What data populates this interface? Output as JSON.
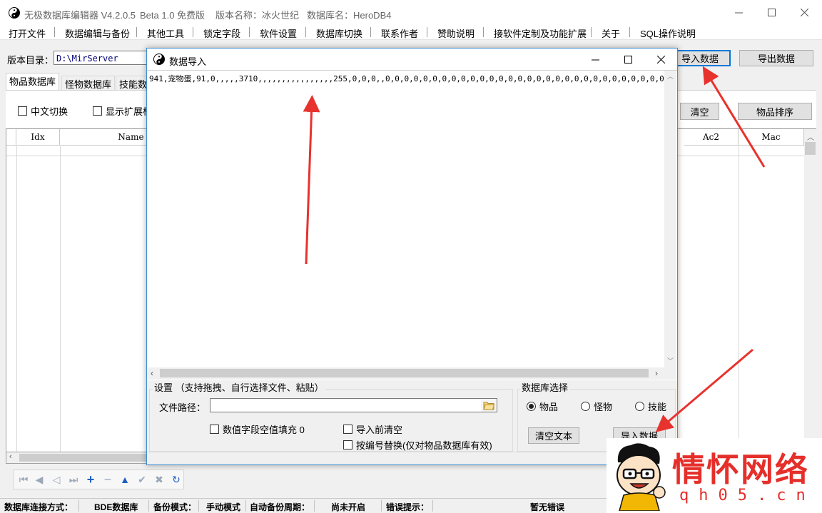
{
  "app": {
    "title_parts": [
      "无极数据库编辑器 V4.2.0.5",
      "Beta 1.0 免费版",
      "版本名称：冰火世纪",
      "数据库名：HeroDB4"
    ]
  },
  "menu": [
    "打开文件",
    "数据编辑与备份",
    "其他工具",
    "锁定字段",
    "软件设置",
    "数据库切换",
    "联系作者",
    "赞助说明",
    "接软件定制及功能扩展",
    "关于",
    "SQL操作说明"
  ],
  "toolbar": {
    "dir_label": "版本目录：",
    "dir_value": "D:\\MirServer",
    "import_button": "导入数据",
    "export_button": "导出数据"
  },
  "tabs": [
    "物品数据库",
    "怪物数据库",
    "技能数"
  ],
  "options": {
    "chinese_switch": "中文切换",
    "show_ext": "显示扩展标",
    "clear_button": "清空",
    "sort_button": "物品排序"
  },
  "grid": {
    "columns_left": [
      "Idx",
      "Name"
    ],
    "columns_right": [
      "Ac2",
      "Mac"
    ]
  },
  "dialog": {
    "title": "数据导入",
    "text_content": "941,宠物蛋,91,0,,,,,3710,,,,,,,,,,,,,,,,255,0,0,0,,0,0,0,0,0,0,0,0,0,0,0,0,0,0,0,0,0,0,0,0,0,0,0,0,0,0,0,0,0,0,0,0,0,0,0",
    "settings_label": "设置  （支持拖拽、自行选择文件、粘贴）",
    "file_path_label": "文件路径：",
    "file_path_value": "",
    "opt_fill_empty": "数值字段空值填充 0",
    "opt_clear_before": "导入前清空",
    "opt_replace_by_id": "按编号替换(仅对物品数据库有效)",
    "db_select_label": "数据库选择",
    "radio_items": "物品",
    "radio_monsters": "怪物",
    "radio_skills": "技能",
    "radio_selected": "物品",
    "clear_text_button": "清空文本",
    "import_button": "导入数据"
  },
  "statusbar": {
    "conn_label": "数据库连接方式：",
    "conn_value": "BDE数据库",
    "backup_label": "备份模式：",
    "backup_value": "手动模式",
    "auto_label": "自动备份周期：",
    "auto_value": "尚未开启",
    "error_label": "错误提示：",
    "error_value": "暂无错误"
  },
  "watermark": {
    "text": "情怀网络",
    "domain": "qh05.cn"
  },
  "colors": {
    "accent": "#0078d7",
    "arrow": "#e8322d",
    "watermark": "#e52f2b"
  }
}
